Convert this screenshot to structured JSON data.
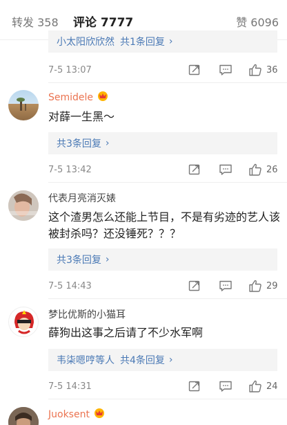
{
  "tabs": {
    "forward": "转发 358",
    "comments": "评论 7777",
    "likes": "赞 6096"
  },
  "comments": [
    {
      "reply_preview": {
        "name": "小太阳欣欣然",
        "count_text": "共1条回复"
      },
      "time": "7-5 13:07",
      "likes": "36"
    },
    {
      "username": "Semidele",
      "text": "对薛一生黑～",
      "reply_preview": {
        "name": "",
        "count_text": "共3条回复"
      },
      "time": "7-5 13:42",
      "likes": "26"
    },
    {
      "username": "代表月亮消灭婊",
      "text": "这个渣男怎么还能上节目，不是有劣迹的艺人该被封杀吗？还没锤死？？？",
      "reply_preview": {
        "name": "",
        "count_text": "共3条回复"
      },
      "time": "7-5 14:43",
      "likes": "29"
    },
    {
      "username": "梦比优斯的小猫耳",
      "text": "薛狗出这事之后请了不少水军啊",
      "reply_preview": {
        "name": "韦柒嗯哼等人",
        "count_text": "共4条回复"
      },
      "time": "7-5 14:31",
      "likes": "24"
    },
    {
      "username": "Juoksent"
    }
  ],
  "colors": {
    "accent": "#ff8200",
    "link": "#4a79b5",
    "vip_name": "#eb7350"
  }
}
